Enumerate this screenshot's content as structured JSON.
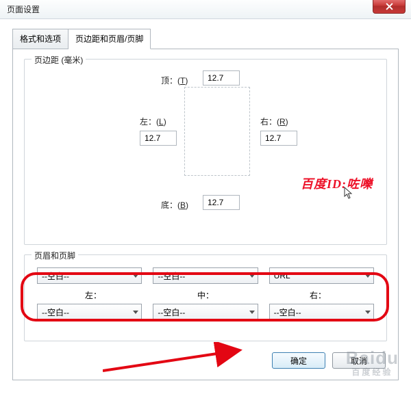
{
  "window": {
    "title": "页面设置"
  },
  "tabs": {
    "t1": "格式和选项",
    "t2": "页边距和页眉/页脚"
  },
  "margins": {
    "legend": "页边距 (毫米)",
    "top_label_pre": "顶：(",
    "top_key": "T",
    "top_label_post": ")",
    "top_val": "12.7",
    "left_label_pre": "左：(",
    "left_key": "L",
    "left_label_post": ")",
    "left_val": "12.7",
    "right_label_pre": "右：(",
    "right_key": "R",
    "right_label_post": ")",
    "right_val": "12.7",
    "bottom_label_pre": "底：(",
    "bottom_key": "B",
    "bottom_label_post": ")",
    "bottom_val": "12.7"
  },
  "annotation": "百度ID:咗嚛",
  "hf": {
    "legend": "页眉和页脚",
    "row1": {
      "c1": "--空白--",
      "c2": "--空白--",
      "c3": "URL"
    },
    "lbl_left": "左：",
    "lbl_center": "中：",
    "lbl_right": "右：",
    "row2": {
      "c1": "--空白--",
      "c2": "--空白--",
      "c3": "--空白--"
    }
  },
  "buttons": {
    "ok": "确定",
    "cancel": "取消"
  },
  "watermark": {
    "main": "Baidu",
    "sub": "百度经验"
  }
}
